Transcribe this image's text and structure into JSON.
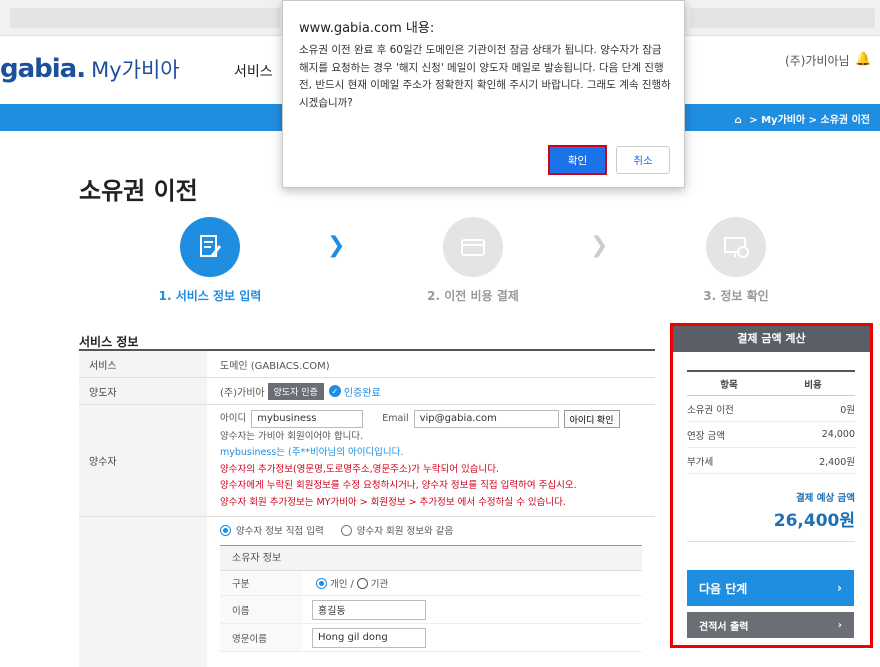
{
  "header": {
    "logo": "gabia.",
    "logo_sub": "My가비아",
    "gnb_item": "서비스",
    "user_name": "(주)가비아님"
  },
  "breadcrumb": [
    "My가비아",
    "소유권 이전"
  ],
  "page_title": "소유권 이전",
  "steps": [
    {
      "label": "1. 서비스 정보 입력",
      "active": true
    },
    {
      "label": "2. 이전 비용 결제",
      "active": false
    },
    {
      "label": "3. 정보 확인",
      "active": false
    }
  ],
  "service_info": {
    "title": "서비스 정보",
    "service_label": "서비스",
    "service_value": "도메인 (GABIACS.COM)",
    "transferor_label": "양도자",
    "transferor_value": "(주)가비아",
    "transferor_button": "양도자 인증",
    "transferor_status": "인증완료",
    "transferee_label": "양수자",
    "id_label": "아이디",
    "id_value": "mybusiness",
    "email_label": "Email",
    "email_value": "vip@gabia.com",
    "id_check_button": "아이디 확인",
    "msg1": "양수자는 가비아 회원이어야 합니다.",
    "msg2": "mybusiness는 (주**비아님의 아이디입니다.",
    "msg3": "양수자의 추가정보(영문명,도로명주소,영문주소)가 누락되어 있습니다.",
    "msg4": "양수자에게 누락된 회원정보를 수정 요청하시거나, 양수자 정보를 직접 입력하여 주십시오.",
    "msg5": "양수자 회원 추가정보는 MY가비아 > 회원정보 > 추가정보 에서 수정하실 수 있습니다.",
    "radio_direct": "양수자 정보 직접 입력",
    "radio_same": "양수자 회원 정보와 같음",
    "owner_info_title": "소유자 정보",
    "type_label": "구분",
    "type_personal": "개인 /",
    "type_org": "기관",
    "name_label": "이름",
    "name_value": "홍길동",
    "eng_name_label": "영문이름",
    "eng_name_value": "Hong gil dong"
  },
  "calc": {
    "title": "결제 금액 계산",
    "col_item": "항목",
    "col_cost": "비용",
    "rows": [
      {
        "item": "소유권 이전",
        "cost": "0원"
      },
      {
        "item": "연장 금액",
        "cost": "24,000"
      },
      {
        "item": "부가세",
        "cost": "2,400원"
      }
    ],
    "expected_label": "결제 예상 금액",
    "expected_value": "26,400원",
    "next_button": "다음 단계",
    "estimate_button": "견적서 출력"
  },
  "dialog": {
    "title": "www.gabia.com 내용:",
    "message": "소유권 이전 완료 후 60일간 도메인은 기관이전 잠금 상태가 됩니다. 양수자가 잠금 해지를 요청하는 경우 '해지 신청' 메일이 양도자 메일로 발송됩니다. 다음 단계 진행 전, 반드시 현재 이메일 주소가 정확한지 확인해 주시기 바랍니다. 그래도 계속 진행하시겠습니까?",
    "ok": "확인",
    "cancel": "취소"
  },
  "colors": {
    "brand_blue": "#1f8ee0",
    "panel_highlight": "#ee0000",
    "dialog_ok": "#1a73e8"
  }
}
